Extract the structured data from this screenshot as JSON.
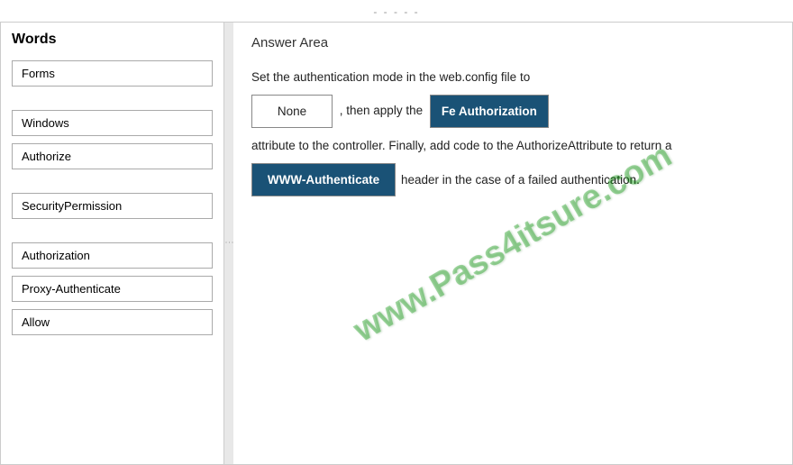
{
  "top": {
    "dots": "- - - - -"
  },
  "left": {
    "title": "Words",
    "items": [
      {
        "label": "Forms"
      },
      {
        "label": "Windows"
      },
      {
        "label": "Authorize"
      },
      {
        "label": "SecurityPermission"
      },
      {
        "label": "Authorization"
      },
      {
        "label": "Proxy-Authenticate"
      },
      {
        "label": "Allow"
      }
    ]
  },
  "right": {
    "title": "Answer Area",
    "intro": "Set the authentication mode in the web.config file to",
    "box1": "None",
    "between1": ", then apply the",
    "box2": "Fe Authorization",
    "line2_before": "attribute to the controller. Finally, add code to the AuthorizeAttribute to return a",
    "box3": "WWW-Authenticate",
    "line3_after": "header in the case of a failed authentication."
  },
  "watermark": "www.Pass4itsure.com"
}
